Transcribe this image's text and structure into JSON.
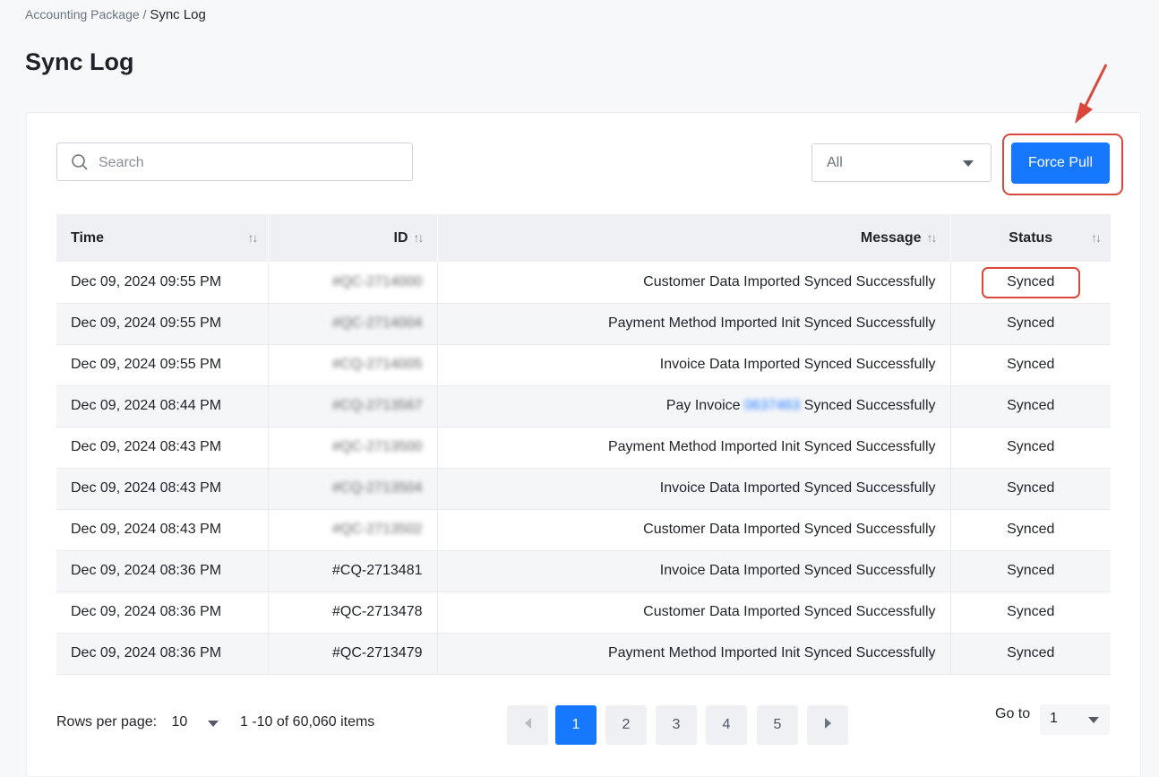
{
  "breadcrumb": {
    "parent": "Accounting Package",
    "separator": "/",
    "current": "Sync Log"
  },
  "page_title": "Sync Log",
  "search": {
    "placeholder": "Search",
    "value": ""
  },
  "filter": {
    "selected": "All"
  },
  "toolbar": {
    "force_pull_label": "Force Pull"
  },
  "table": {
    "headers": {
      "time": "Time",
      "id": "ID",
      "message": "Message",
      "status": "Status"
    },
    "sort_glyph": "↑↓",
    "rows": [
      {
        "time": "Dec 09, 2024 09:55 PM",
        "id": "#QC-2714000",
        "message": "Customer Data Imported Synced Successfully",
        "status": "Synced"
      },
      {
        "time": "Dec 09, 2024 09:55 PM",
        "id": "#QC-2714004",
        "message": "Payment Method Imported Init Synced Successfully",
        "status": "Synced"
      },
      {
        "time": "Dec 09, 2024 09:55 PM",
        "id": "#CQ-2714005",
        "message": "Invoice Data Imported Synced Successfully",
        "status": "Synced"
      },
      {
        "time": "Dec 09, 2024 08:44 PM",
        "id": "#CQ-2713567",
        "message_prefix": "Pay Invoice",
        "message_link": "0637463",
        "message_suffix": "Synced Successfully",
        "status": "Synced"
      },
      {
        "time": "Dec 09, 2024 08:43 PM",
        "id": "#QC-2713500",
        "message": "Payment Method Imported Init Synced Successfully",
        "status": "Synced"
      },
      {
        "time": "Dec 09, 2024 08:43 PM",
        "id": "#CQ-2713504",
        "message": "Invoice Data Imported Synced Successfully",
        "status": "Synced"
      },
      {
        "time": "Dec 09, 2024 08:43 PM",
        "id": "#QC-2713502",
        "message": "Customer Data Imported Synced Successfully",
        "status": "Synced"
      },
      {
        "time": "Dec 09, 2024 08:36 PM",
        "id": "#CQ-2713481",
        "message": "Invoice Data Imported Synced Successfully",
        "status": "Synced"
      },
      {
        "time": "Dec 09, 2024 08:36 PM",
        "id": "#QC-2713478",
        "message": "Customer Data Imported Synced Successfully",
        "status": "Synced"
      },
      {
        "time": "Dec 09, 2024 08:36 PM",
        "id": "#QC-2713479",
        "message": "Payment Method Imported Init Synced Successfully",
        "status": "Synced"
      }
    ]
  },
  "pagination": {
    "rows_per_page_label": "Rows per page:",
    "rows_per_page": "10",
    "range": "1 -10 of 60,060",
    "items_label": "items",
    "pages": [
      "1",
      "2",
      "3",
      "4",
      "5"
    ],
    "current_page": "1",
    "goto_label": "Go to",
    "goto_value": "1"
  },
  "colors": {
    "accent": "#1677ff",
    "highlight": "#d9483b"
  },
  "icons": {
    "search": "search-icon",
    "prev": "prev-page-icon",
    "next": "next-page-icon",
    "dropdown": "chevron-down-icon"
  }
}
